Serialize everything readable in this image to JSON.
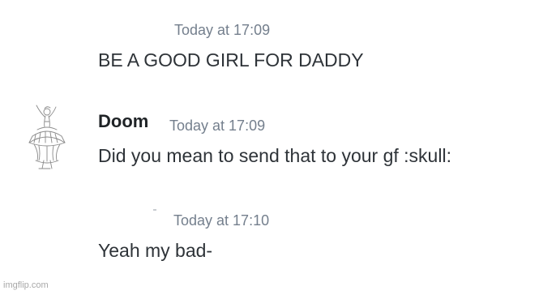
{
  "messages": [
    {
      "timestamp": "Today at 17:09",
      "text": "BE A GOOD GIRL FOR DADDY"
    },
    {
      "author": "Doom",
      "timestamp": "Today at 17:09",
      "text": "Did you mean to send that to your gf :skull:",
      "avatar_icon": "ballerina-sketch-icon"
    },
    {
      "timestamp": "Today at 17:10",
      "text": "Yeah my bad-"
    }
  ],
  "watermark": "imgflip.com",
  "colors": {
    "background": "#ffffff",
    "timestamp": "#747f8d",
    "text": "#2e3338",
    "author": "#1f2326"
  }
}
